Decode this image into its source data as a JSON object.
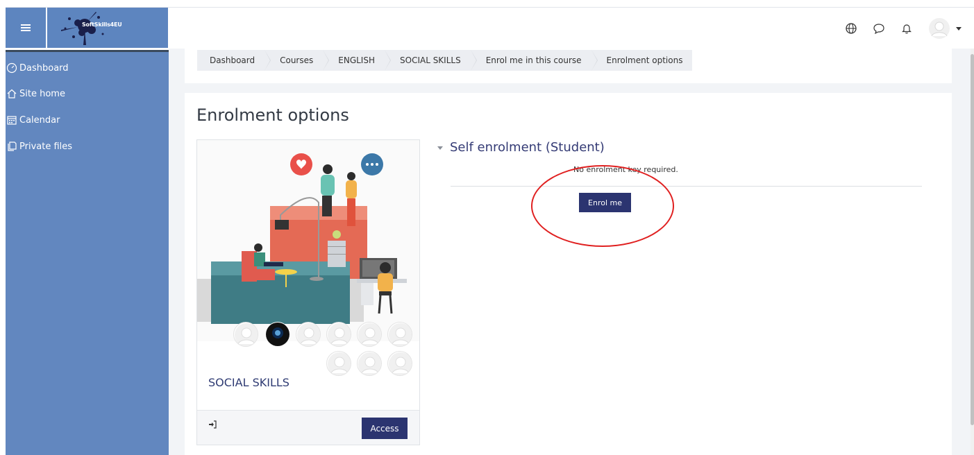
{
  "navbar": {
    "logo_text": "SoftSkills4EU"
  },
  "sidebar": {
    "items": [
      {
        "label": "Dashboard"
      },
      {
        "label": "Site home"
      },
      {
        "label": "Calendar"
      },
      {
        "label": "Private files"
      }
    ]
  },
  "breadcrumb": {
    "items": [
      {
        "label": "Dashboard"
      },
      {
        "label": "Courses"
      },
      {
        "label": "ENGLISH"
      },
      {
        "label": "SOCIAL SKILLS"
      },
      {
        "label": "Enrol me in this course"
      },
      {
        "label": "Enrolment options"
      }
    ]
  },
  "page": {
    "title": "Enrolment options"
  },
  "course": {
    "name": "SOCIAL SKILLS",
    "access_label": "Access"
  },
  "self_enrol": {
    "title": "Self enrolment (Student)",
    "note": "No enrolment key required.",
    "button_label": "Enrol me"
  },
  "colors": {
    "sidebar": "#6287bf",
    "primary_button": "#2b3470",
    "annotation": "#e02020"
  }
}
